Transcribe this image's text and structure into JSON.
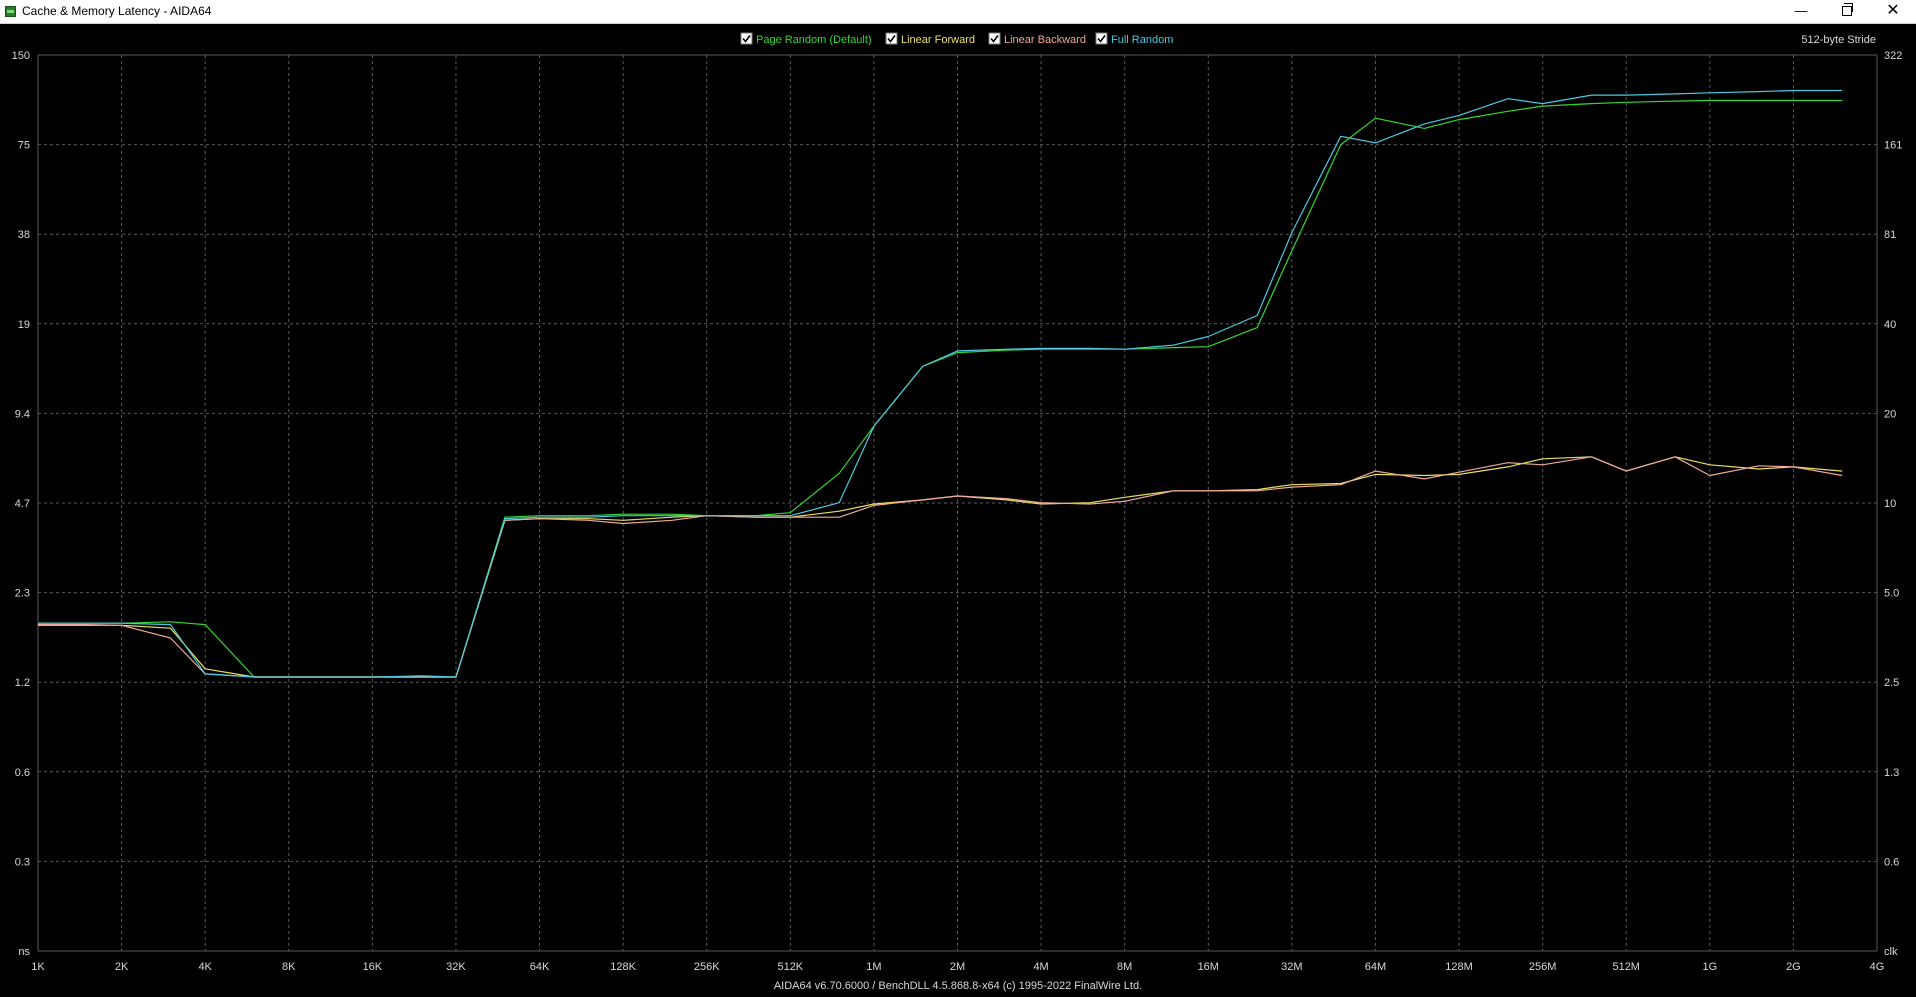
{
  "window": {
    "title": "Cache & Memory Latency - AIDA64",
    "minimize_glyph": "—",
    "close_glyph": "✕"
  },
  "colors": {
    "background": "#000000",
    "grid": "#5a5a5a",
    "text": "#d8d8d8"
  },
  "chart_data": {
    "type": "line",
    "stride_label": "512-byte Stride",
    "footer": "AIDA64 v6.70.6000 / BenchDLL 4.5.868.8-x64  (c) 1995-2022 FinalWire Ltd.",
    "log_scale_x": true,
    "log_scale_y": true,
    "grid": true,
    "legend_position": "top-center",
    "x_ticks": [
      "1K",
      "2K",
      "4K",
      "8K",
      "16K",
      "32K",
      "64K",
      "128K",
      "256K",
      "512K",
      "1M",
      "2M",
      "4M",
      "8M",
      "16M",
      "32M",
      "64M",
      "128M",
      "256M",
      "512M",
      "1G",
      "2G",
      "4G"
    ],
    "y_left_ticks": [
      "150",
      "75",
      "38",
      "19",
      "9.4",
      "4.7",
      "2.3",
      "1.2",
      "0.6",
      "0.3",
      "ns"
    ],
    "y_right_ticks": [
      "322",
      "161",
      "81",
      "40",
      "20",
      "10",
      "5.0",
      "2.5",
      "1.3",
      "0.6",
      "clk"
    ],
    "x": [
      1,
      1.5,
      2,
      3,
      4,
      6,
      8,
      12,
      16,
      24,
      32,
      48,
      64,
      96,
      128,
      192,
      256,
      384,
      512,
      768,
      1024,
      1536,
      2048,
      3072,
      4096,
      6144,
      8192,
      12288,
      16384,
      24576,
      32768,
      49152,
      65536,
      98304,
      131072,
      196608,
      262144,
      393216,
      524288,
      786432,
      1048576,
      1572864,
      2097152,
      3145728
    ],
    "x_unit": "KB",
    "series": [
      {
        "name": "Page Random (Default)",
        "color": "#33d633",
        "checked": true,
        "values": [
          1.85,
          1.85,
          1.85,
          1.87,
          1.83,
          1.22,
          1.22,
          1.22,
          1.22,
          1.22,
          1.22,
          4.2,
          4.25,
          4.25,
          4.3,
          4.3,
          4.25,
          4.25,
          4.35,
          5.9,
          8.5,
          13.5,
          15.0,
          15.3,
          15.4,
          15.4,
          15.4,
          15.6,
          15.7,
          18.2,
          33.0,
          75.0,
          92.0,
          85.0,
          91.0,
          97.0,
          101.0,
          103.0,
          104.0,
          105.0,
          105.5,
          105.5,
          105.5,
          105.5
        ]
      },
      {
        "name": "Linear Forward",
        "color": "#e8e060",
        "checked": true,
        "values": [
          1.82,
          1.82,
          1.82,
          1.78,
          1.3,
          1.22,
          1.22,
          1.22,
          1.22,
          1.22,
          1.22,
          4.1,
          4.15,
          4.15,
          4.1,
          4.2,
          4.25,
          4.2,
          4.2,
          4.4,
          4.65,
          4.8,
          4.95,
          4.8,
          4.65,
          4.7,
          4.9,
          5.15,
          5.15,
          5.2,
          5.4,
          5.45,
          5.85,
          5.8,
          5.85,
          6.2,
          6.6,
          6.7,
          6.0,
          6.7,
          6.3,
          6.1,
          6.2,
          6.0
        ]
      },
      {
        "name": "Linear Backward",
        "color": "#f0a898",
        "checked": true,
        "values": [
          1.83,
          1.83,
          1.82,
          1.65,
          1.25,
          1.22,
          1.22,
          1.22,
          1.22,
          1.22,
          1.22,
          4.1,
          4.15,
          4.1,
          4.0,
          4.1,
          4.25,
          4.2,
          4.2,
          4.2,
          4.6,
          4.8,
          4.95,
          4.85,
          4.7,
          4.65,
          4.75,
          5.15,
          5.15,
          5.15,
          5.3,
          5.4,
          6.0,
          5.65,
          5.95,
          6.4,
          6.3,
          6.7,
          6.0,
          6.7,
          5.8,
          6.25,
          6.2,
          5.8
        ]
      },
      {
        "name": "Full Random",
        "color": "#4cc8e0",
        "checked": true,
        "values": [
          1.85,
          1.85,
          1.85,
          1.83,
          1.25,
          1.22,
          1.22,
          1.22,
          1.22,
          1.23,
          1.22,
          4.15,
          4.2,
          4.2,
          4.25,
          4.25,
          4.25,
          4.25,
          4.25,
          4.7,
          8.5,
          13.5,
          15.2,
          15.4,
          15.5,
          15.5,
          15.4,
          15.9,
          17.0,
          20.0,
          38.0,
          80.0,
          76.0,
          88.0,
          94.0,
          107.0,
          103.0,
          110.0,
          110.0,
          111.0,
          112.0,
          113.0,
          114.0,
          114.0
        ]
      }
    ]
  }
}
